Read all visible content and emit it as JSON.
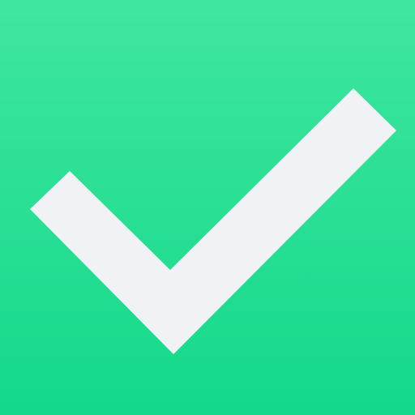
{
  "icon": {
    "name": "checkmark-icon",
    "background_top": "#3fe69f",
    "background_bottom": "#14d98a",
    "mark_color": "#f0f2f6"
  }
}
